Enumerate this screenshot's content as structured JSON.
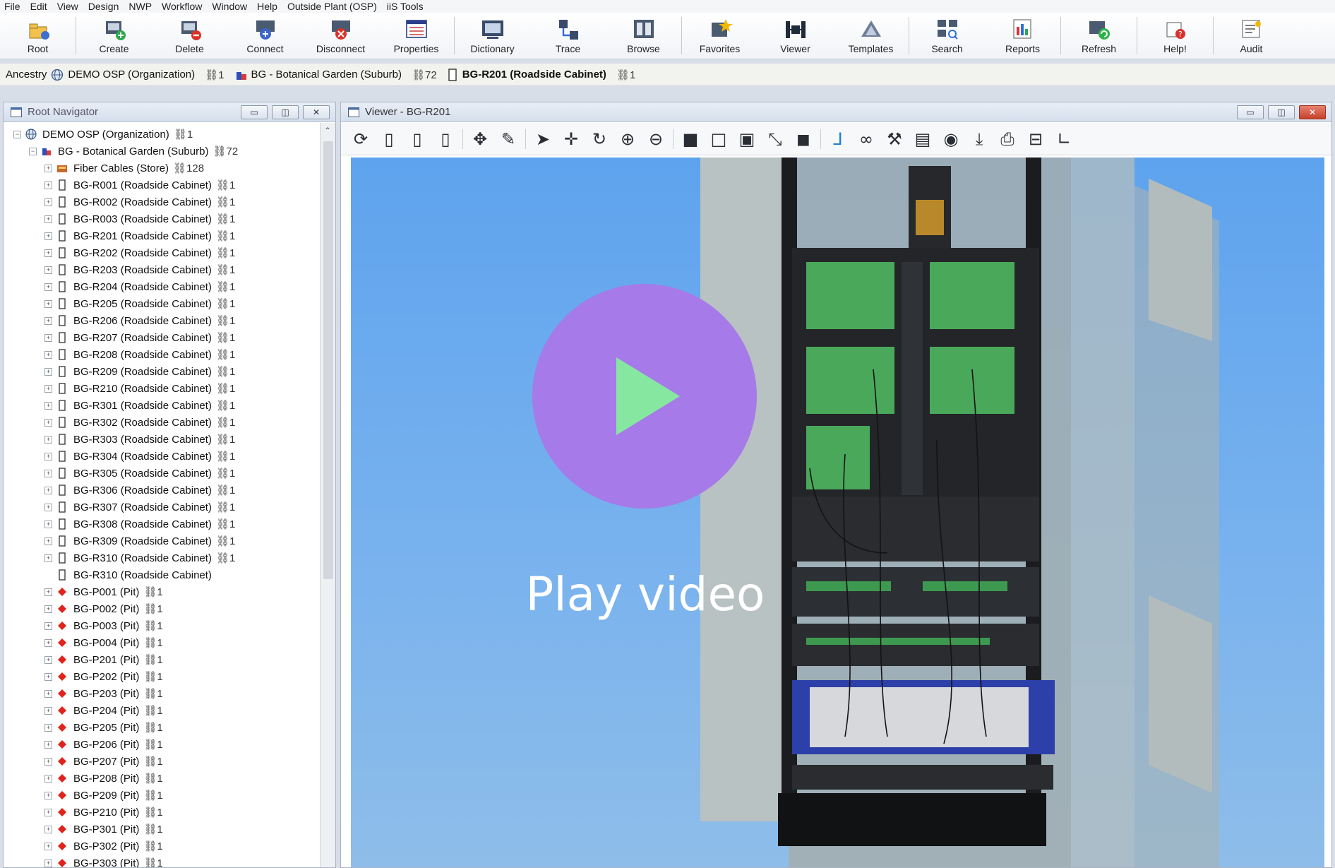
{
  "menu": [
    "File",
    "Edit",
    "View",
    "Design",
    "NWP",
    "Workflow",
    "Window",
    "Help",
    "Outside Plant (OSP)",
    "iiS Tools"
  ],
  "ribbon": [
    {
      "label": "Root",
      "icon": "root-icon"
    },
    {
      "label": "Create",
      "icon": "create-icon"
    },
    {
      "label": "Delete",
      "icon": "delete-icon"
    },
    {
      "label": "Connect",
      "icon": "connect-icon"
    },
    {
      "label": "Disconnect",
      "icon": "disconnect-icon"
    },
    {
      "label": "Properties",
      "icon": "properties-icon"
    },
    {
      "label": "Dictionary",
      "icon": "dictionary-icon"
    },
    {
      "label": "Trace",
      "icon": "trace-icon"
    },
    {
      "label": "Browse",
      "icon": "browse-icon"
    },
    {
      "label": "Favorites",
      "icon": "favorites-icon"
    },
    {
      "label": "Viewer",
      "icon": "viewer-icon"
    },
    {
      "label": "Templates",
      "icon": "templates-icon"
    },
    {
      "label": "Search",
      "icon": "search-icon"
    },
    {
      "label": "Reports",
      "icon": "reports-icon"
    },
    {
      "label": "Refresh",
      "icon": "refresh-icon"
    },
    {
      "label": "Help!",
      "icon": "help-icon"
    },
    {
      "label": "Audit",
      "icon": "audit-icon"
    }
  ],
  "ancestry": {
    "label": "Ancestry",
    "items": [
      {
        "text": "DEMO OSP (Organization)",
        "count": "⛓1",
        "bold": false
      },
      {
        "text": "BG - Botanical Garden (Suburb)",
        "count": "⛓72",
        "bold": false
      },
      {
        "text": "BG-R201 (Roadside Cabinet)",
        "count": "⛓1",
        "bold": true
      }
    ]
  },
  "navigator": {
    "title": "Root Navigator",
    "rows": [
      {
        "level": 0,
        "text": "DEMO OSP  (Organization)",
        "count": "⛓1",
        "icon": "globe",
        "exp": "−"
      },
      {
        "level": 1,
        "text": "BG - Botanical Garden  (Suburb)",
        "count": "⛓72",
        "icon": "suburb",
        "exp": "−"
      },
      {
        "level": 2,
        "text": "Fiber Cables  (Store)",
        "count": "⛓128",
        "icon": "store",
        "exp": "+"
      },
      {
        "level": 2,
        "text": "BG-R001  (Roadside Cabinet)",
        "count": "⛓1",
        "icon": "cabinet",
        "exp": "+"
      },
      {
        "level": 2,
        "text": "BG-R002  (Roadside Cabinet)",
        "count": "⛓1",
        "icon": "cabinet",
        "exp": "+"
      },
      {
        "level": 2,
        "text": "BG-R003  (Roadside Cabinet)",
        "count": "⛓1",
        "icon": "cabinet",
        "exp": "+"
      },
      {
        "level": 2,
        "text": "BG-R201  (Roadside Cabinet)",
        "count": "⛓1",
        "icon": "cabinet",
        "exp": "+"
      },
      {
        "level": 2,
        "text": "BG-R202  (Roadside Cabinet)",
        "count": "⛓1",
        "icon": "cabinet",
        "exp": "+"
      },
      {
        "level": 2,
        "text": "BG-R203  (Roadside Cabinet)",
        "count": "⛓1",
        "icon": "cabinet",
        "exp": "+"
      },
      {
        "level": 2,
        "text": "BG-R204  (Roadside Cabinet)",
        "count": "⛓1",
        "icon": "cabinet",
        "exp": "+"
      },
      {
        "level": 2,
        "text": "BG-R205  (Roadside Cabinet)",
        "count": "⛓1",
        "icon": "cabinet",
        "exp": "+"
      },
      {
        "level": 2,
        "text": "BG-R206  (Roadside Cabinet)",
        "count": "⛓1",
        "icon": "cabinet",
        "exp": "+"
      },
      {
        "level": 2,
        "text": "BG-R207  (Roadside Cabinet)",
        "count": "⛓1",
        "icon": "cabinet",
        "exp": "+"
      },
      {
        "level": 2,
        "text": "BG-R208  (Roadside Cabinet)",
        "count": "⛓1",
        "icon": "cabinet",
        "exp": "+"
      },
      {
        "level": 2,
        "text": "BG-R209  (Roadside Cabinet)",
        "count": "⛓1",
        "icon": "cabinet",
        "exp": "+"
      },
      {
        "level": 2,
        "text": "BG-R210  (Roadside Cabinet)",
        "count": "⛓1",
        "icon": "cabinet",
        "exp": "+"
      },
      {
        "level": 2,
        "text": "BG-R301  (Roadside Cabinet)",
        "count": "⛓1",
        "icon": "cabinet",
        "exp": "+"
      },
      {
        "level": 2,
        "text": "BG-R302  (Roadside Cabinet)",
        "count": "⛓1",
        "icon": "cabinet",
        "exp": "+"
      },
      {
        "level": 2,
        "text": "BG-R303  (Roadside Cabinet)",
        "count": "⛓1",
        "icon": "cabinet",
        "exp": "+"
      },
      {
        "level": 2,
        "text": "BG-R304  (Roadside Cabinet)",
        "count": "⛓1",
        "icon": "cabinet",
        "exp": "+"
      },
      {
        "level": 2,
        "text": "BG-R305  (Roadside Cabinet)",
        "count": "⛓1",
        "icon": "cabinet",
        "exp": "+"
      },
      {
        "level": 2,
        "text": "BG-R306  (Roadside Cabinet)",
        "count": "⛓1",
        "icon": "cabinet",
        "exp": "+"
      },
      {
        "level": 2,
        "text": "BG-R307  (Roadside Cabinet)",
        "count": "⛓1",
        "icon": "cabinet",
        "exp": "+"
      },
      {
        "level": 2,
        "text": "BG-R308  (Roadside Cabinet)",
        "count": "⛓1",
        "icon": "cabinet",
        "exp": "+"
      },
      {
        "level": 2,
        "text": "BG-R309  (Roadside Cabinet)",
        "count": "⛓1",
        "icon": "cabinet",
        "exp": "+"
      },
      {
        "level": 2,
        "text": "BG-R310  (Roadside Cabinet)",
        "count": "⛓1",
        "icon": "cabinet",
        "exp": "+"
      },
      {
        "level": 2,
        "text": "BG-R310  (Roadside Cabinet)",
        "count": "",
        "icon": "cabinet",
        "exp": ""
      },
      {
        "level": 2,
        "text": "BG-P001  (Pit)",
        "count": "⛓1",
        "icon": "pit",
        "exp": "+"
      },
      {
        "level": 2,
        "text": "BG-P002  (Pit)",
        "count": "⛓1",
        "icon": "pit",
        "exp": "+"
      },
      {
        "level": 2,
        "text": "BG-P003  (Pit)",
        "count": "⛓1",
        "icon": "pit",
        "exp": "+"
      },
      {
        "level": 2,
        "text": "BG-P004  (Pit)",
        "count": "⛓1",
        "icon": "pit",
        "exp": "+"
      },
      {
        "level": 2,
        "text": "BG-P201  (Pit)",
        "count": "⛓1",
        "icon": "pit",
        "exp": "+"
      },
      {
        "level": 2,
        "text": "BG-P202  (Pit)",
        "count": "⛓1",
        "icon": "pit",
        "exp": "+"
      },
      {
        "level": 2,
        "text": "BG-P203  (Pit)",
        "count": "⛓1",
        "icon": "pit",
        "exp": "+"
      },
      {
        "level": 2,
        "text": "BG-P204  (Pit)",
        "count": "⛓1",
        "icon": "pit",
        "exp": "+"
      },
      {
        "level": 2,
        "text": "BG-P205  (Pit)",
        "count": "⛓1",
        "icon": "pit",
        "exp": "+"
      },
      {
        "level": 2,
        "text": "BG-P206  (Pit)",
        "count": "⛓1",
        "icon": "pit",
        "exp": "+"
      },
      {
        "level": 2,
        "text": "BG-P207  (Pit)",
        "count": "⛓1",
        "icon": "pit",
        "exp": "+"
      },
      {
        "level": 2,
        "text": "BG-P208  (Pit)",
        "count": "⛓1",
        "icon": "pit",
        "exp": "+"
      },
      {
        "level": 2,
        "text": "BG-P209  (Pit)",
        "count": "⛓1",
        "icon": "pit",
        "exp": "+"
      },
      {
        "level": 2,
        "text": "BG-P210  (Pit)",
        "count": "⛓1",
        "icon": "pit",
        "exp": "+"
      },
      {
        "level": 2,
        "text": "BG-P301  (Pit)",
        "count": "⛓1",
        "icon": "pit",
        "exp": "+"
      },
      {
        "level": 2,
        "text": "BG-P302  (Pit)",
        "count": "⛓1",
        "icon": "pit",
        "exp": "+"
      },
      {
        "level": 2,
        "text": "BG-P303  (Pit)",
        "count": "⛓1",
        "icon": "pit",
        "exp": "+"
      }
    ]
  },
  "viewer": {
    "title": "Viewer - BG-R201",
    "tools": [
      "rotate-icon",
      "front-view-icon",
      "side-view-icon",
      "back-view-icon",
      "pan-orbit-icon",
      "paint-icon",
      "select-arrow-icon",
      "move-icon",
      "spin-icon",
      "zoom-in-icon",
      "zoom-out-icon",
      "solid-view-icon",
      "wireframe-icon",
      "hidden-line-icon",
      "connect-view-icon",
      "fill-view-icon",
      "trace-path-icon",
      "binoculars-icon",
      "wrench-icon",
      "display-icon",
      "eye-icon",
      "download-icon",
      "print-icon",
      "save-icon",
      "measure-icon"
    ]
  },
  "overlay": {
    "label": "Play video",
    "circle_color": "#a67ae8",
    "triangle_color": "#86e8a0"
  },
  "colors": {
    "sky_top": "#5ea3ee",
    "sky_bottom": "#8ebde9",
    "rack": "#1d1f22",
    "panel_green": "#56b866"
  }
}
